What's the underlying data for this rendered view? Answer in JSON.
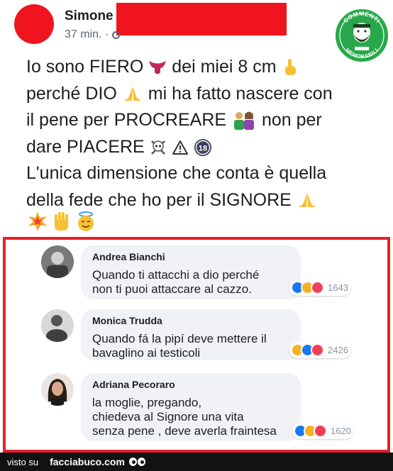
{
  "post": {
    "author": "Simone",
    "time": "37 min. ·",
    "lines": [
      "Io sono FIERO",
      "dei miei 8 cm",
      "perché DIO",
      "mi ha fatto nascere con",
      "il pene per PROCREARE",
      "non per",
      "dare PIACERE",
      "L'unica dimensione che conta è quella",
      "della fede che ho per il  SIGNORE"
    ],
    "badge_18": "18"
  },
  "logo": {
    "top_text": "COMMENTI",
    "bottom_text": "MEMORABILI",
    "bg": "#27a84a"
  },
  "comments": [
    {
      "author": "Andrea Bianchi",
      "text": "Quando ti attacchi a dio perché\nnon ti puoi attaccare al cazzo.",
      "reactions": [
        "like",
        "haha",
        "love"
      ],
      "count": "1643"
    },
    {
      "author": "Monica Trudda",
      "text": "Quando fá la pipí deve mettere il\nbavaglino ai testicoli",
      "reactions": [
        "haha",
        "like",
        "love"
      ],
      "count": "2426"
    },
    {
      "author": "Adriana Pecoraro",
      "text": "la moglie, pregando,\nchiedeva al Signore una vita\nsenza pene , deve averla fraintesa",
      "reactions": [
        "like",
        "haha",
        "love"
      ],
      "count": "1620"
    }
  ],
  "footer": {
    "prefix": "visto su",
    "site": "facciabuco.com"
  },
  "colors": {
    "redaction": "#f0141e",
    "frame": "#e3202a",
    "like": "#1877f2",
    "haha": "#f7b125",
    "love": "#f33e58"
  }
}
